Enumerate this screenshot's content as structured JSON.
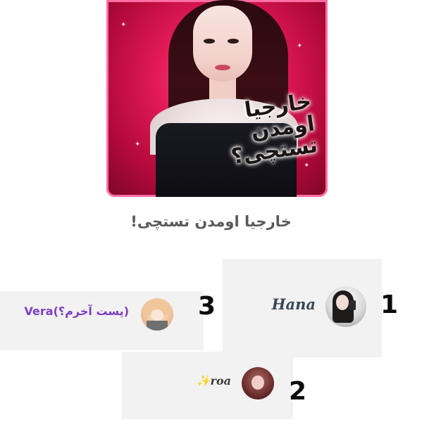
{
  "cover": {
    "text_lines": [
      "خارجیا",
      "اومدن",
      "تستچی؟"
    ]
  },
  "title": "خارجیا اومدن تستچی!",
  "leaderboard": [
    {
      "rank": "1",
      "name": "Hana",
      "name_color": "#3b4658"
    },
    {
      "rank": "2",
      "name": "✨roa",
      "name_color": "#3b3b3b"
    },
    {
      "rank": "3",
      "name": "Vera(پست آخرم؟)",
      "name_color": "#7b3fc1"
    }
  ]
}
